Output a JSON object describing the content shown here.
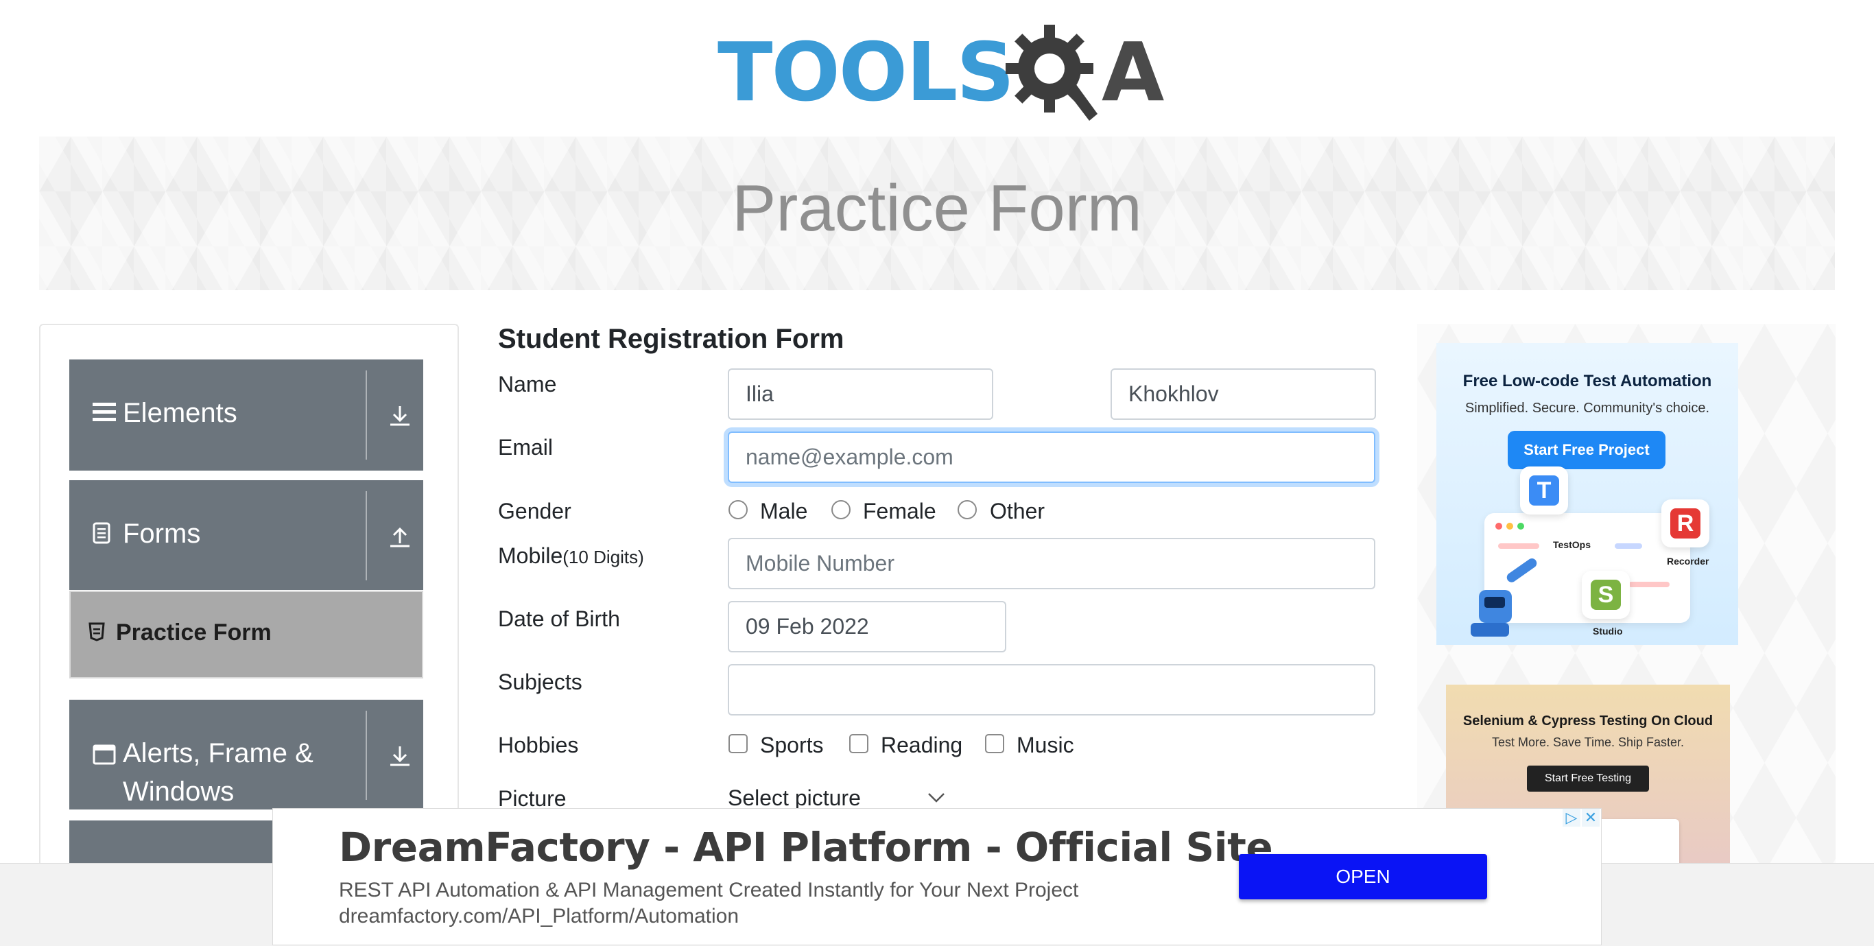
{
  "logo": {
    "tools": "TOOLS",
    "a": "A"
  },
  "banner": {
    "title": "Practice Form"
  },
  "sidebar": {
    "groups": [
      {
        "label": "Elements",
        "icon": "hamburger-icon",
        "arrow": "download-arrow-icon"
      },
      {
        "label": "Forms",
        "icon": "document-icon",
        "arrow": "upload-arrow-icon"
      },
      {
        "label": "Alerts, Frame &",
        "label2": "Windows",
        "icon": "window-icon",
        "arrow": "download-arrow-icon"
      }
    ],
    "active_item": {
      "label": "Practice Form",
      "icon": "html5-icon"
    }
  },
  "form": {
    "title": "Student Registration Form",
    "name_label": "Name",
    "first_name": "Ilia",
    "last_name": "Khokhlov",
    "email_label": "Email",
    "email_placeholder": "name@example.com",
    "gender_label": "Gender",
    "genders": [
      "Male",
      "Female",
      "Other"
    ],
    "mobile_label": "Mobile",
    "mobile_hint": "(10 Digits)",
    "mobile_placeholder": "Mobile Number",
    "dob_label": "Date of Birth",
    "dob_value": "09 Feb 2022",
    "subjects_label": "Subjects",
    "hobbies_label": "Hobbies",
    "hobbies": [
      "Sports",
      "Reading",
      "Music"
    ],
    "picture_label": "Picture",
    "picture_button": "Select picture"
  },
  "ads": {
    "right1": {
      "title": "Free Low-code Test Automation",
      "subtitle": "Simplified. Secure. Community's choice.",
      "button": "Start Free Project",
      "tiles": [
        "TestOps",
        "Recorder",
        "Studio"
      ]
    },
    "right2": {
      "title": "Selenium & Cypress Testing On Cloud",
      "subtitle": "Test More. Save Time. Ship Faster.",
      "button": "Start Free Testing"
    },
    "bottom": {
      "title": "DreamFactory - API Platform - Official Site",
      "description": "REST API Automation & API Management Created Instantly for Your Next Project",
      "url": "dreamfactory.com/API_Platform/Automation",
      "button": "OPEN"
    }
  },
  "colors": {
    "brand_blue": "#3b9bd6",
    "sidebar_group": "#6c757d",
    "active_item": "#a9a9a9",
    "ad_open": "#0a14f5"
  }
}
